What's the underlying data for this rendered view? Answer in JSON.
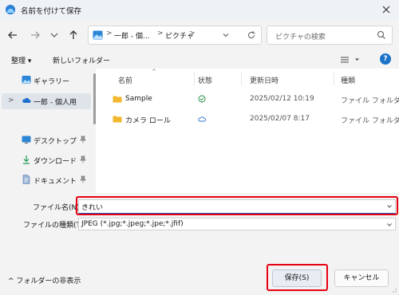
{
  "window": {
    "title": "名前を付けて保存"
  },
  "nav": {
    "breadcrumbs": [
      "一郎 - 個...",
      "ピクチャ"
    ],
    "search_placeholder": "ピクチャの検索"
  },
  "commands": {
    "organize": "整理 ▾",
    "new_folder": "新しいフォルダー",
    "help": "?"
  },
  "sidebar": {
    "items": [
      {
        "label": "ギャラリー"
      },
      {
        "label": "一郎 - 個人用"
      },
      {
        "label": "デスクトップ"
      },
      {
        "label": "ダウンロード"
      },
      {
        "label": "ドキュメント"
      }
    ]
  },
  "files": {
    "columns": [
      "名前",
      "状態",
      "更新日時",
      "種類"
    ],
    "rows": [
      {
        "name": "Sample",
        "date": "2025/02/12 10:19",
        "type": "ファイル フォルダー",
        "status": "synced-check-icon"
      },
      {
        "name": "カメラ ロール",
        "date": "2025/02/07 8:17",
        "type": "ファイル フォルダー",
        "status": "cloud-icon"
      }
    ]
  },
  "form": {
    "filename_label": "ファイル名(N):",
    "filename_value": "きれい",
    "filetype_label": "ファイルの種類(T):",
    "filetype_value": "JPEG (*.jpg;*.jpeg;*.jpe;*.jfif)"
  },
  "footer": {
    "hide_folders": "^ フォルダーの非表示",
    "save": "保存(S)",
    "cancel": "キャンセル"
  },
  "colors": {
    "accent": "#1a73c8",
    "highlight": "#e60012",
    "folder": "#f2b72d"
  }
}
